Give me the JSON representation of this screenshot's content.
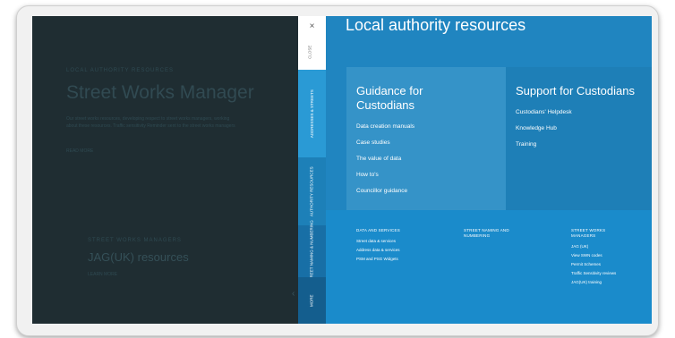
{
  "background_page": {
    "breadcrumb": "LOCAL AUTHORITY RESOURCES",
    "title": "Street Works Manager",
    "paragraph_line1": "Our street works resources, developing respect to street works managers, working",
    "paragraph_line2": "about these resources. Traffic sensitivity Reminder sent to the street works managers",
    "small_link": "READ MORE",
    "kicker": "STREET WORKS MANAGERS",
    "subheading": "JAG(UK) resources",
    "sub_link": "LEARN MORE"
  },
  "side_tabs": {
    "close_glyph": "×",
    "close_label": "CLOSE",
    "tabs": [
      {
        "label": "ADDRESSES & STREETS"
      },
      {
        "label": "AUTHORITY RESOURCES"
      },
      {
        "label": "STREET NAMING & NUMBERING"
      },
      {
        "label": "MORE"
      }
    ]
  },
  "panel": {
    "title": "Local authority resources",
    "guidance": {
      "heading_line1": "Guidance for",
      "heading_line2": "Custodians",
      "items": [
        "Data creation manuals",
        "Case studies",
        "The value of data",
        "How to's",
        "Councillor guidance"
      ]
    },
    "support": {
      "heading": "Support for Custodians",
      "items": [
        "Custodians' Helpdesk",
        "Knowledge Hub",
        "Training"
      ]
    },
    "columns": {
      "data": {
        "heading_line1": "DATA AND SERVICES",
        "heading_line2": "",
        "items": [
          "Street data & services",
          "Address data & services",
          "PSM and PSG Widgets"
        ]
      },
      "naming": {
        "heading_line1": "STREET NAMING AND",
        "heading_line2": "NUMBERING",
        "items": []
      },
      "street": {
        "heading_line1": "STREET WORKS",
        "heading_line2": "MANAGERS",
        "items": [
          "JAG (UK)",
          "View SWN codes",
          "Permit Schemes",
          "Traffic Sensitivity reviews",
          "JAG(UK) training"
        ]
      }
    }
  },
  "colors": {
    "dark_bg": "#1f2d32",
    "panel_bg": "#2085c0",
    "guidance_card": "#3593c8",
    "support_card": "#1e7fb7",
    "bottom_bg": "#1a8bcb",
    "tab_bg": "#1d8cc8"
  }
}
